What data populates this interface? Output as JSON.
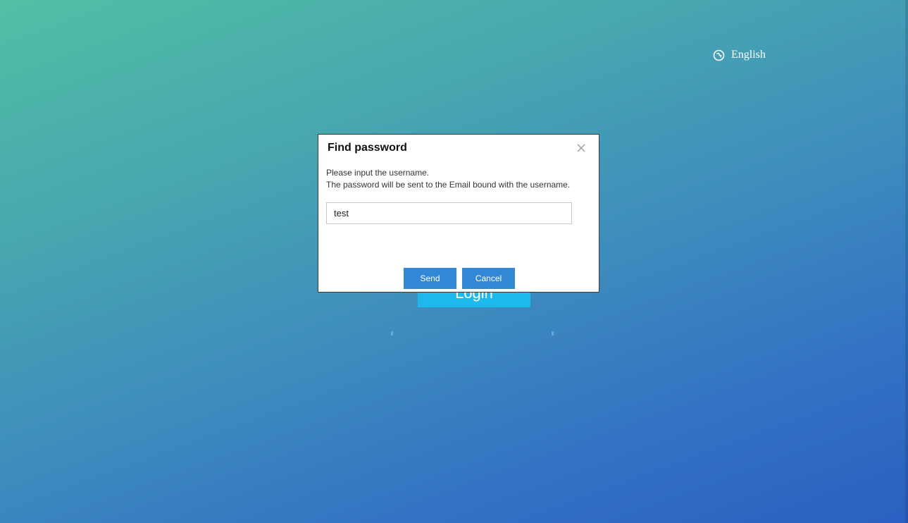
{
  "language": {
    "icon": "globe-icon",
    "label": "English"
  },
  "background_page": {
    "login_button_label": "Login"
  },
  "dialog": {
    "title": "Find password",
    "close_icon": "close-icon",
    "message_line1": "Please input the username.",
    "message_line2": "The password will be sent to the Email bound with the username.",
    "username_value": "test",
    "send_label": "Send",
    "cancel_label": "Cancel"
  },
  "colors": {
    "gradient_start": "#52bfa4",
    "gradient_end": "#2b60c2",
    "login_button": "#1db8ec",
    "dialog_button": "#3388d6"
  }
}
